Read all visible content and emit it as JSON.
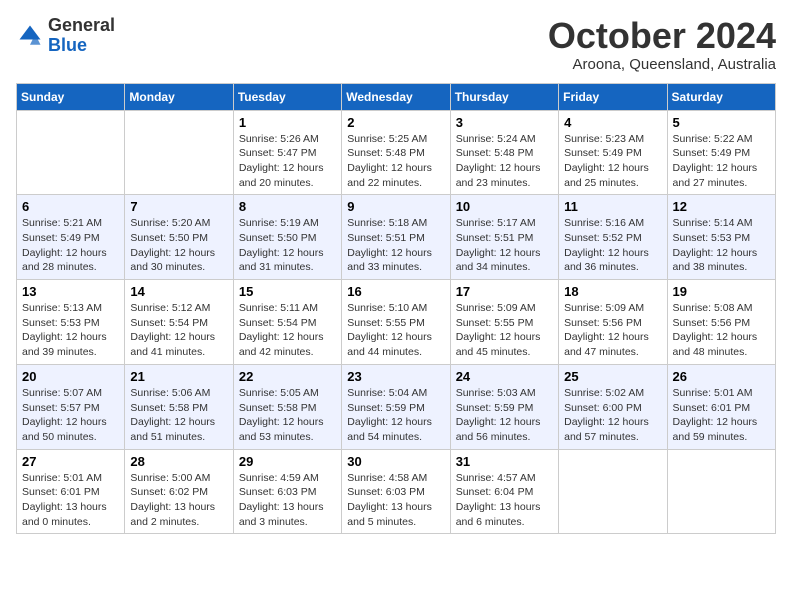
{
  "header": {
    "logo_line1": "General",
    "logo_line2": "Blue",
    "month": "October 2024",
    "location": "Aroona, Queensland, Australia"
  },
  "days_of_week": [
    "Sunday",
    "Monday",
    "Tuesday",
    "Wednesday",
    "Thursday",
    "Friday",
    "Saturday"
  ],
  "weeks": [
    [
      {
        "day": "",
        "sunrise": "",
        "sunset": "",
        "daylight": ""
      },
      {
        "day": "",
        "sunrise": "",
        "sunset": "",
        "daylight": ""
      },
      {
        "day": "1",
        "sunrise": "Sunrise: 5:26 AM",
        "sunset": "Sunset: 5:47 PM",
        "daylight": "Daylight: 12 hours and 20 minutes."
      },
      {
        "day": "2",
        "sunrise": "Sunrise: 5:25 AM",
        "sunset": "Sunset: 5:48 PM",
        "daylight": "Daylight: 12 hours and 22 minutes."
      },
      {
        "day": "3",
        "sunrise": "Sunrise: 5:24 AM",
        "sunset": "Sunset: 5:48 PM",
        "daylight": "Daylight: 12 hours and 23 minutes."
      },
      {
        "day": "4",
        "sunrise": "Sunrise: 5:23 AM",
        "sunset": "Sunset: 5:49 PM",
        "daylight": "Daylight: 12 hours and 25 minutes."
      },
      {
        "day": "5",
        "sunrise": "Sunrise: 5:22 AM",
        "sunset": "Sunset: 5:49 PM",
        "daylight": "Daylight: 12 hours and 27 minutes."
      }
    ],
    [
      {
        "day": "6",
        "sunrise": "Sunrise: 5:21 AM",
        "sunset": "Sunset: 5:49 PM",
        "daylight": "Daylight: 12 hours and 28 minutes."
      },
      {
        "day": "7",
        "sunrise": "Sunrise: 5:20 AM",
        "sunset": "Sunset: 5:50 PM",
        "daylight": "Daylight: 12 hours and 30 minutes."
      },
      {
        "day": "8",
        "sunrise": "Sunrise: 5:19 AM",
        "sunset": "Sunset: 5:50 PM",
        "daylight": "Daylight: 12 hours and 31 minutes."
      },
      {
        "day": "9",
        "sunrise": "Sunrise: 5:18 AM",
        "sunset": "Sunset: 5:51 PM",
        "daylight": "Daylight: 12 hours and 33 minutes."
      },
      {
        "day": "10",
        "sunrise": "Sunrise: 5:17 AM",
        "sunset": "Sunset: 5:51 PM",
        "daylight": "Daylight: 12 hours and 34 minutes."
      },
      {
        "day": "11",
        "sunrise": "Sunrise: 5:16 AM",
        "sunset": "Sunset: 5:52 PM",
        "daylight": "Daylight: 12 hours and 36 minutes."
      },
      {
        "day": "12",
        "sunrise": "Sunrise: 5:14 AM",
        "sunset": "Sunset: 5:53 PM",
        "daylight": "Daylight: 12 hours and 38 minutes."
      }
    ],
    [
      {
        "day": "13",
        "sunrise": "Sunrise: 5:13 AM",
        "sunset": "Sunset: 5:53 PM",
        "daylight": "Daylight: 12 hours and 39 minutes."
      },
      {
        "day": "14",
        "sunrise": "Sunrise: 5:12 AM",
        "sunset": "Sunset: 5:54 PM",
        "daylight": "Daylight: 12 hours and 41 minutes."
      },
      {
        "day": "15",
        "sunrise": "Sunrise: 5:11 AM",
        "sunset": "Sunset: 5:54 PM",
        "daylight": "Daylight: 12 hours and 42 minutes."
      },
      {
        "day": "16",
        "sunrise": "Sunrise: 5:10 AM",
        "sunset": "Sunset: 5:55 PM",
        "daylight": "Daylight: 12 hours and 44 minutes."
      },
      {
        "day": "17",
        "sunrise": "Sunrise: 5:09 AM",
        "sunset": "Sunset: 5:55 PM",
        "daylight": "Daylight: 12 hours and 45 minutes."
      },
      {
        "day": "18",
        "sunrise": "Sunrise: 5:09 AM",
        "sunset": "Sunset: 5:56 PM",
        "daylight": "Daylight: 12 hours and 47 minutes."
      },
      {
        "day": "19",
        "sunrise": "Sunrise: 5:08 AM",
        "sunset": "Sunset: 5:56 PM",
        "daylight": "Daylight: 12 hours and 48 minutes."
      }
    ],
    [
      {
        "day": "20",
        "sunrise": "Sunrise: 5:07 AM",
        "sunset": "Sunset: 5:57 PM",
        "daylight": "Daylight: 12 hours and 50 minutes."
      },
      {
        "day": "21",
        "sunrise": "Sunrise: 5:06 AM",
        "sunset": "Sunset: 5:58 PM",
        "daylight": "Daylight: 12 hours and 51 minutes."
      },
      {
        "day": "22",
        "sunrise": "Sunrise: 5:05 AM",
        "sunset": "Sunset: 5:58 PM",
        "daylight": "Daylight: 12 hours and 53 minutes."
      },
      {
        "day": "23",
        "sunrise": "Sunrise: 5:04 AM",
        "sunset": "Sunset: 5:59 PM",
        "daylight": "Daylight: 12 hours and 54 minutes."
      },
      {
        "day": "24",
        "sunrise": "Sunrise: 5:03 AM",
        "sunset": "Sunset: 5:59 PM",
        "daylight": "Daylight: 12 hours and 56 minutes."
      },
      {
        "day": "25",
        "sunrise": "Sunrise: 5:02 AM",
        "sunset": "Sunset: 6:00 PM",
        "daylight": "Daylight: 12 hours and 57 minutes."
      },
      {
        "day": "26",
        "sunrise": "Sunrise: 5:01 AM",
        "sunset": "Sunset: 6:01 PM",
        "daylight": "Daylight: 12 hours and 59 minutes."
      }
    ],
    [
      {
        "day": "27",
        "sunrise": "Sunrise: 5:01 AM",
        "sunset": "Sunset: 6:01 PM",
        "daylight": "Daylight: 13 hours and 0 minutes."
      },
      {
        "day": "28",
        "sunrise": "Sunrise: 5:00 AM",
        "sunset": "Sunset: 6:02 PM",
        "daylight": "Daylight: 13 hours and 2 minutes."
      },
      {
        "day": "29",
        "sunrise": "Sunrise: 4:59 AM",
        "sunset": "Sunset: 6:03 PM",
        "daylight": "Daylight: 13 hours and 3 minutes."
      },
      {
        "day": "30",
        "sunrise": "Sunrise: 4:58 AM",
        "sunset": "Sunset: 6:03 PM",
        "daylight": "Daylight: 13 hours and 5 minutes."
      },
      {
        "day": "31",
        "sunrise": "Sunrise: 4:57 AM",
        "sunset": "Sunset: 6:04 PM",
        "daylight": "Daylight: 13 hours and 6 minutes."
      },
      {
        "day": "",
        "sunrise": "",
        "sunset": "",
        "daylight": ""
      },
      {
        "day": "",
        "sunrise": "",
        "sunset": "",
        "daylight": ""
      }
    ]
  ]
}
